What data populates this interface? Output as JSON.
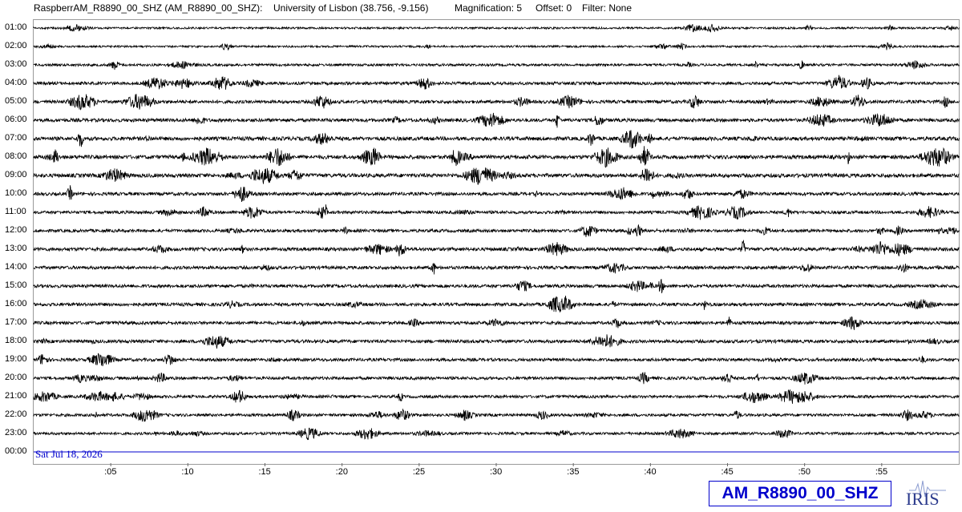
{
  "header": {
    "station": "RaspberrAM_R8890_00_SHZ (AM_R8890_00_SHZ):",
    "location": "University of Lisbon (38.756, -9.156)",
    "magnification": "Magnification: 5",
    "offset": "Offset: 0",
    "filter": "Filter: None"
  },
  "hours": [
    "01:00",
    "02:00",
    "03:00",
    "04:00",
    "05:00",
    "06:00",
    "07:00",
    "08:00",
    "09:00",
    "10:00",
    "11:00",
    "12:00",
    "13:00",
    "14:00",
    "15:00",
    "16:00",
    "17:00",
    "18:00",
    "19:00",
    "20:00",
    "21:00",
    "22:00",
    "23:00",
    "00:00"
  ],
  "date_stamp": "Sat Jul 18, 2026",
  "xaxis_ticks": [
    ":05",
    ":10",
    ":15",
    ":20",
    ":25",
    ":30",
    ":35",
    ":40",
    ":45",
    ":50",
    ":55"
  ],
  "station_badge": "AM_R8890_00_SHZ",
  "logo_text": "IRIS",
  "colors": {
    "trace": "#000000",
    "current_line": "#0000cc",
    "badge": "#0000cc"
  }
}
